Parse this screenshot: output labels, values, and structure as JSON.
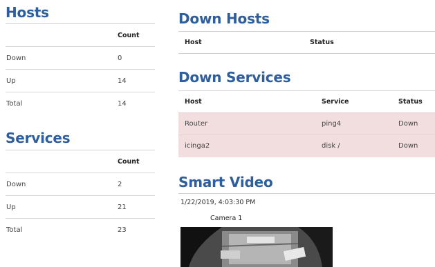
{
  "hosts": {
    "title": "Hosts",
    "count_header": "Count",
    "rows": [
      {
        "label": "Down",
        "count": "0"
      },
      {
        "label": "Up",
        "count": "14"
      },
      {
        "label": "Total",
        "count": "14"
      }
    ]
  },
  "services": {
    "title": "Services",
    "count_header": "Count",
    "rows": [
      {
        "label": "Down",
        "count": "2"
      },
      {
        "label": "Up",
        "count": "21"
      },
      {
        "label": "Total",
        "count": "23"
      }
    ]
  },
  "down_hosts": {
    "title": "Down Hosts",
    "headers": {
      "host": "Host",
      "status": "Status"
    }
  },
  "down_services": {
    "title": "Down Services",
    "headers": {
      "host": "Host",
      "service": "Service",
      "status": "Status"
    },
    "rows": [
      {
        "host": "Router",
        "service": "ping4",
        "status": "Down"
      },
      {
        "host": "icinga2",
        "service": "disk /",
        "status": "Down"
      }
    ]
  },
  "smart_video": {
    "title": "Smart Video",
    "timestamp": "1/22/2019, 4:03:30 PM",
    "camera_label": "Camera 1"
  },
  "colors": {
    "heading": "#2e5e9e",
    "down_row": "#f2dede"
  }
}
